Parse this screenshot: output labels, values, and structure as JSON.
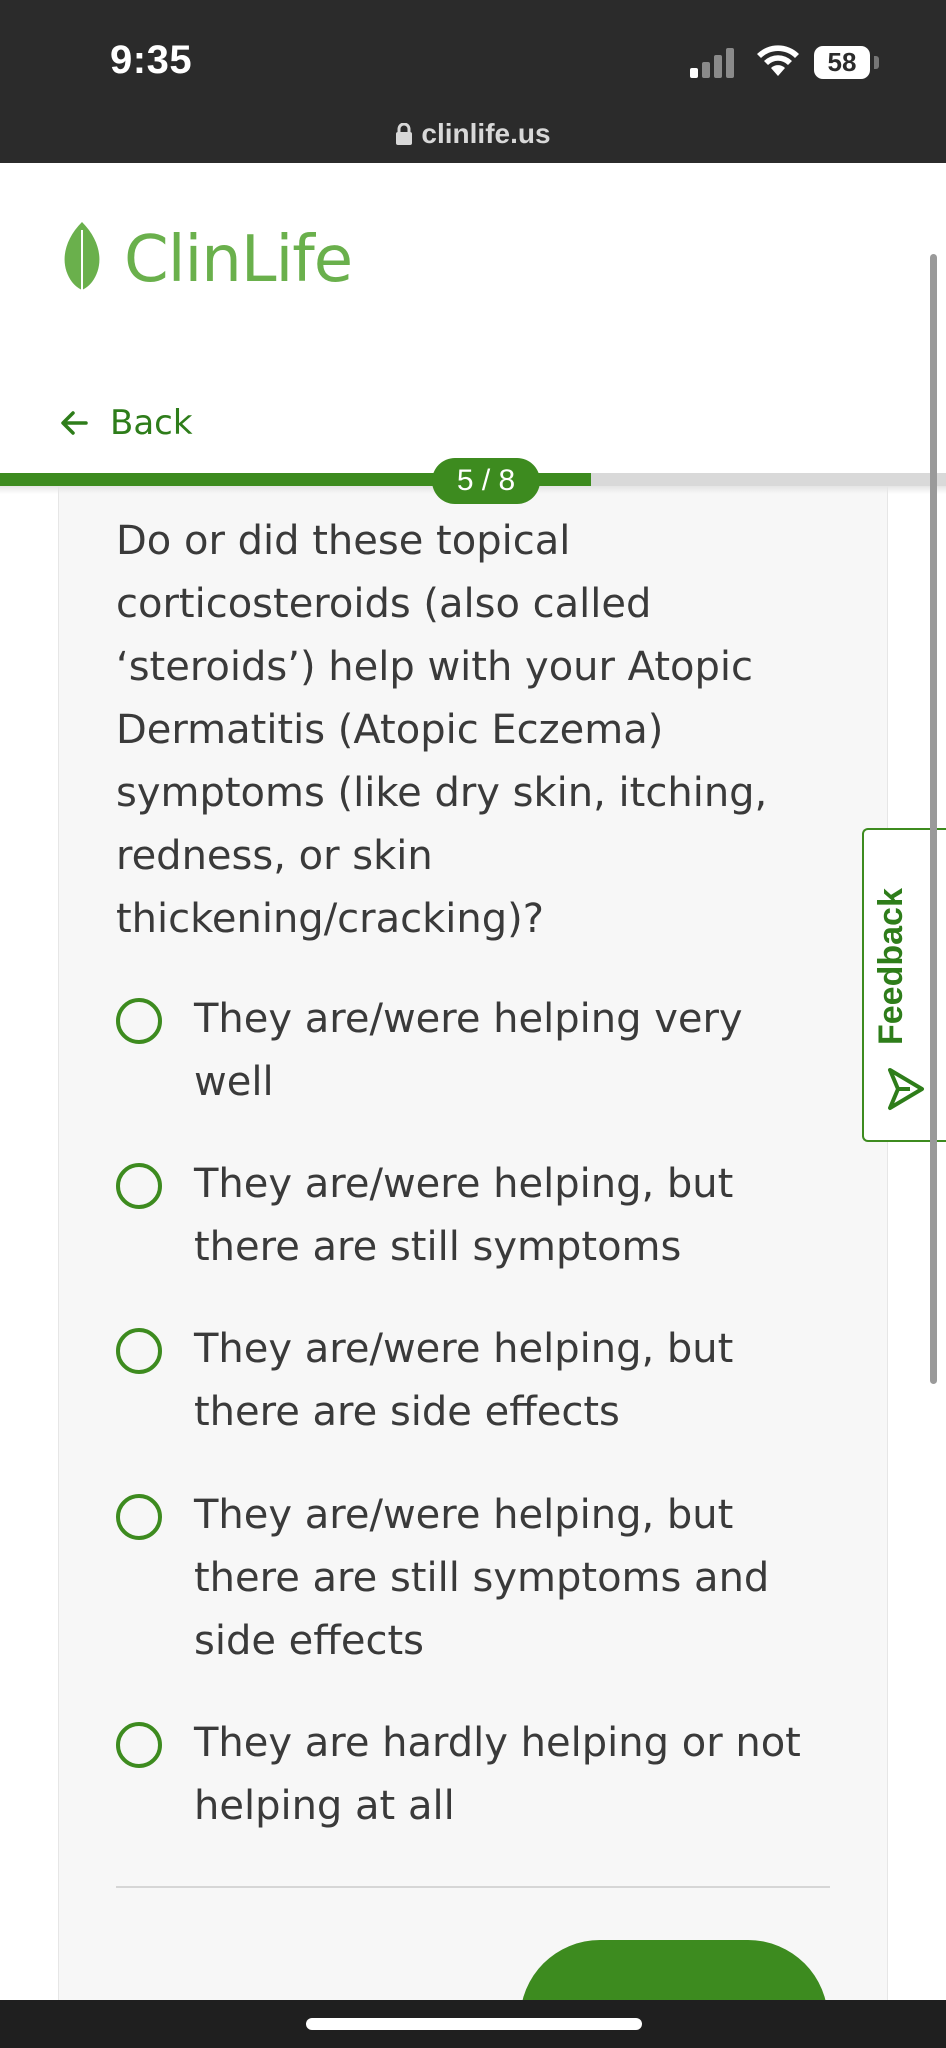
{
  "status_bar": {
    "time": "9:35",
    "battery": "58",
    "signal_icon": "cellular-signal-icon",
    "wifi_icon": "wifi-icon"
  },
  "browser": {
    "url": "clinlife.us",
    "lock_icon": "lock-icon"
  },
  "header": {
    "logo_text": "ClinLife",
    "logo_icon": "leaf-icon",
    "back_label": "Back",
    "brand_color": "#6ab04c",
    "accent_color": "#3d8b1f"
  },
  "progress": {
    "label": "5 / 8",
    "current": 5,
    "total": 8
  },
  "question": {
    "text": "Do or did these topical corticosteroids (also called ‘steroids’) help with your Atopic Dermatitis (Atopic Eczema) symptoms (like dry skin, itching, redness, or skin thickening/cracking)?",
    "options": [
      {
        "label": "They are/were helping very well",
        "selected": false
      },
      {
        "label": "They are/were helping, but there are still symptoms",
        "selected": false
      },
      {
        "label": "They are/were helping, but there are side effects",
        "selected": false
      },
      {
        "label": "They are/were helping, but there are still symptoms and side effects",
        "selected": false
      },
      {
        "label": "They are hardly helping or not helping at all",
        "selected": false
      }
    ]
  },
  "feedback": {
    "label": "Feedback",
    "icon": "send-icon"
  }
}
